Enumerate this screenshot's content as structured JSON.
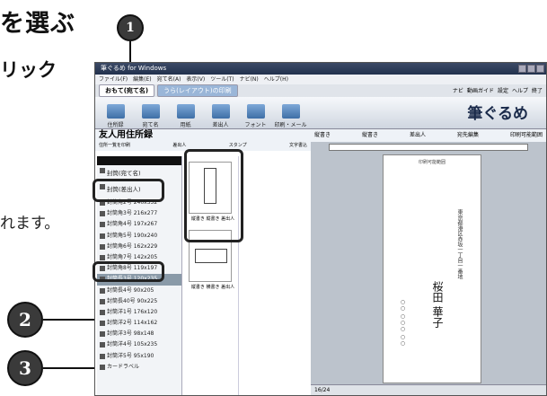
{
  "heading": "を選ぶ",
  "sub_heading": "リック",
  "side_text": "れます。",
  "callouts": [
    "1",
    "2",
    "3"
  ],
  "window": {
    "title": "筆ぐるめ for Windows",
    "menu": [
      "ファイル(F)",
      "編集(E)",
      "宛て名(A)",
      "表示(V)",
      "ツール(T)",
      "ナビ(N)",
      "ヘルプ(H)"
    ],
    "tabs": [
      "おもて(宛て名)",
      "うら(レイアウト)の印刷"
    ],
    "tab_tools": [
      "ナビ",
      "動画ガイド",
      "設定",
      "ヘルプ",
      "終了"
    ],
    "toolbar": [
      "住所録",
      "宛て名",
      "用紙",
      "差出人",
      "フォント",
      "印刷・メール"
    ],
    "brand": "筆ぐるめ"
  },
  "left_panel": {
    "title": "友人用住所録",
    "tools": [
      "住所一覧を印刷",
      "差出人",
      "スタンプ",
      "文字書込"
    ],
    "list_items": [
      {
        "label": "封筒(宛て名)",
        "tall": true
      },
      {
        "label": "封筒(差出人)",
        "tall": true
      },
      {
        "label": "封筒角2号 240x332"
      },
      {
        "label": "封筒角3号 216x277"
      },
      {
        "label": "封筒角4号 197x267"
      },
      {
        "label": "封筒角5号 190x240"
      },
      {
        "label": "封筒角6号 162x229"
      },
      {
        "label": "封筒角7号 142x205"
      },
      {
        "label": "封筒角8号 119x197"
      },
      {
        "label": "封筒長3号 120x235",
        "selected": true
      },
      {
        "label": "封筒長4号 90x205"
      },
      {
        "label": "封筒長40号 90x225"
      },
      {
        "label": "封筒洋1号 176x120"
      },
      {
        "label": "封筒洋2号 114x162"
      },
      {
        "label": "封筒洋3号 98x148"
      },
      {
        "label": "封筒洋4号 105x235"
      },
      {
        "label": "封筒洋5号 95x190"
      },
      {
        "label": "カードラベル"
      }
    ],
    "thumbs": [
      "縦書き 縦書き 差出人",
      "縦書き 横書き 差出人"
    ]
  },
  "right_panel": {
    "tools": [
      "縦書き",
      "縦書き",
      "差出人",
      "宛先編集",
      "印刷可能範囲"
    ],
    "paper_header": "印刷可能範囲",
    "recipient_name": "桜田 華子",
    "recipient_address": "東京都港区赤坂一丁目一番地",
    "sender_address": "○○ ○○○ ○○",
    "page_indicator": "16/24"
  }
}
